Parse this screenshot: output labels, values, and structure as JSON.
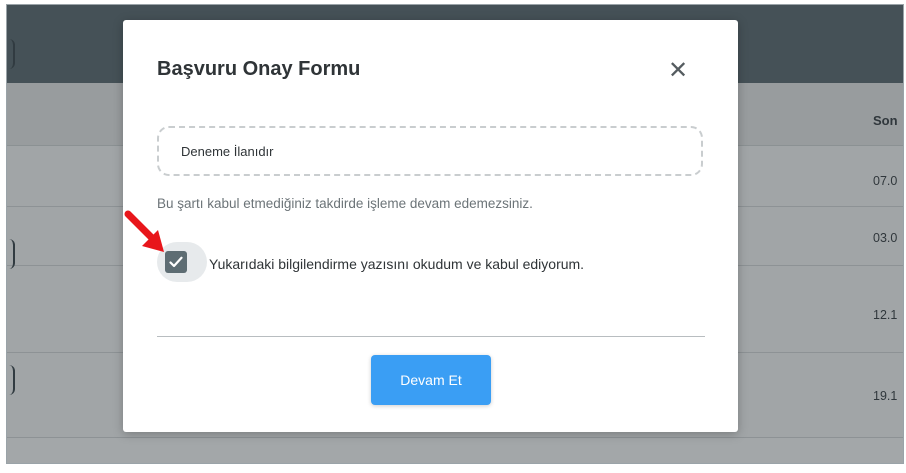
{
  "background": {
    "table_header": "Son",
    "row_dates": [
      "07.0",
      "03.0",
      "12.1",
      "19.1"
    ]
  },
  "modal": {
    "title": "Başvuru Onay Formu",
    "close_icon": "close-icon",
    "listing_name": "Deneme İlanıdır",
    "warning_text": "Bu şartı kabul etmediğiniz takdirde işleme devam edemezsiniz.",
    "checkbox_label": "Yukarıdaki bilgilendirme yazısını okudum ve kabul ediyorum.",
    "checkbox_checked": true,
    "continue_label": "Devam Et"
  },
  "annotation": {
    "arrow_icon": "red-arrow-icon",
    "arrow_color": "#e8161b"
  },
  "colors": {
    "primary_button": "#3a9ef4",
    "header_bar": "#5e6d73",
    "checkbox_fill": "#5e6d73"
  }
}
